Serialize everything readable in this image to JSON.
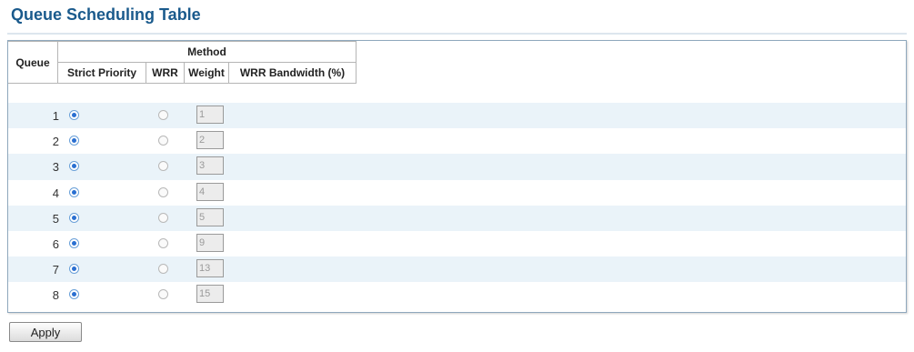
{
  "page": {
    "title": "Queue Scheduling Table"
  },
  "table": {
    "headers": {
      "queue": "Queue",
      "method": "Method",
      "strict_priority": "Strict Priority",
      "wrr": "WRR",
      "weight": "Weight",
      "wrr_bandwidth": "WRR Bandwidth (%)"
    },
    "rows": [
      {
        "queue": "1",
        "method": "strict_priority",
        "weight": "1",
        "bandwidth": ""
      },
      {
        "queue": "2",
        "method": "strict_priority",
        "weight": "2",
        "bandwidth": ""
      },
      {
        "queue": "3",
        "method": "strict_priority",
        "weight": "3",
        "bandwidth": ""
      },
      {
        "queue": "4",
        "method": "strict_priority",
        "weight": "4",
        "bandwidth": ""
      },
      {
        "queue": "5",
        "method": "strict_priority",
        "weight": "5",
        "bandwidth": ""
      },
      {
        "queue": "6",
        "method": "strict_priority",
        "weight": "9",
        "bandwidth": ""
      },
      {
        "queue": "7",
        "method": "strict_priority",
        "weight": "13",
        "bandwidth": ""
      },
      {
        "queue": "8",
        "method": "strict_priority",
        "weight": "15",
        "bandwidth": ""
      }
    ]
  },
  "actions": {
    "apply_label": "Apply"
  },
  "colors": {
    "title": "#1a5a8c",
    "row_alt": "#eaf3f9",
    "radio_checked": "#2a6fd1",
    "panel_border": "#8fa8bd"
  }
}
